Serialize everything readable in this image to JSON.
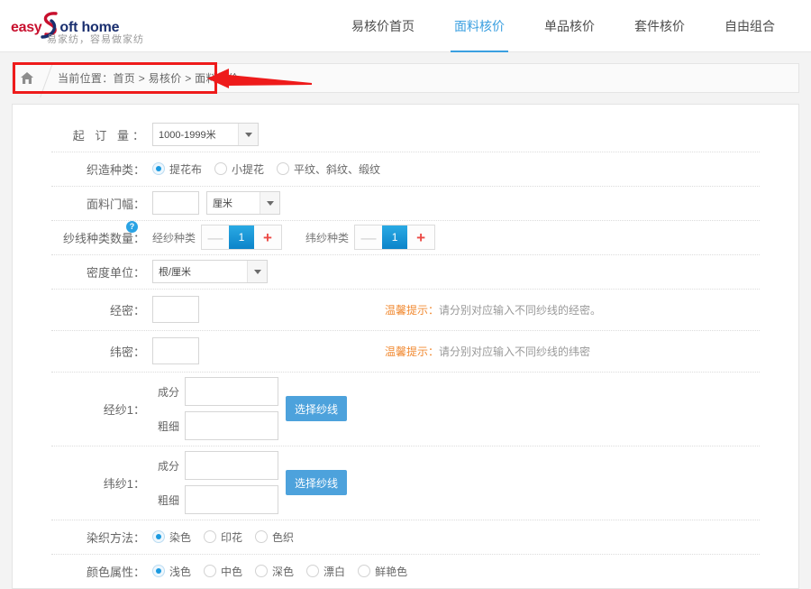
{
  "brand": {
    "easy": "easy",
    "oft_home": "oft home",
    "subtitle": "易家纺，容易做家纺",
    "accent_red": "#c8102e",
    "accent_navy": "#1a2f6f"
  },
  "nav": {
    "items": [
      {
        "label": "易核价首页",
        "active": false
      },
      {
        "label": "面料核价",
        "active": true
      },
      {
        "label": "单品核价",
        "active": false
      },
      {
        "label": "套件核价",
        "active": false
      },
      {
        "label": "自由组合",
        "active": false
      }
    ],
    "active_color": "#3a9fe0"
  },
  "breadcrumb": {
    "home_icon": "home-icon",
    "text": "当前位置：首页 > 易核价 > 面料核价"
  },
  "annotation": {
    "color": "#ee1b1b",
    "shape": "rectangle-and-left-arrow"
  },
  "form": {
    "moq": {
      "label": "起 订 量：",
      "select_value": "1000-1999米"
    },
    "weave_type": {
      "label": "织造种类：",
      "options": [
        {
          "label": "提花布",
          "selected": true
        },
        {
          "label": "小提花",
          "selected": false
        },
        {
          "label": "平纹、斜纹、缎纹",
          "selected": false
        }
      ]
    },
    "fabric_width": {
      "label": "面料门幅：",
      "value": "",
      "unit_value": "厘米"
    },
    "yarn_count": {
      "label": "纱线种类数量",
      "colon": "：",
      "help_icon": "question-mark-icon",
      "warp": {
        "label": "经纱种类",
        "minus": "—",
        "value": "1",
        "plus": "+"
      },
      "weft": {
        "label": "纬纱种类",
        "minus": "—",
        "value": "1",
        "plus": "+"
      }
    },
    "density_unit": {
      "label": "密度单位：",
      "select_value": "根/厘米"
    },
    "warp_density": {
      "label": "经密：",
      "value": "",
      "tip_prefix": "温馨提示：",
      "tip_text": "请分别对应输入不同纱线的经密。"
    },
    "weft_density": {
      "label": "纬密：",
      "value": "",
      "tip_prefix": "温馨提示：",
      "tip_text": "请分别对应输入不同纱线的纬密"
    },
    "warp_yarn_1": {
      "label": "经纱1：",
      "composition_label": "成分",
      "composition_value": "",
      "thickness_label": "粗细",
      "thickness_value": "",
      "button": "选择纱线"
    },
    "weft_yarn_1": {
      "label": "纬纱1：",
      "composition_label": "成分",
      "composition_value": "",
      "thickness_label": "粗细",
      "thickness_value": "",
      "button": "选择纱线"
    },
    "dye_method": {
      "label": "染织方法：",
      "options": [
        {
          "label": "染色",
          "selected": true
        },
        {
          "label": "印花",
          "selected": false
        },
        {
          "label": "色织",
          "selected": false
        }
      ]
    },
    "color_attr": {
      "label": "颜色属性：",
      "options": [
        {
          "label": "浅色",
          "selected": true
        },
        {
          "label": "中色",
          "selected": false
        },
        {
          "label": "深色",
          "selected": false
        },
        {
          "label": "漂白",
          "selected": false
        },
        {
          "label": "鲜艳色",
          "selected": false
        }
      ]
    }
  }
}
